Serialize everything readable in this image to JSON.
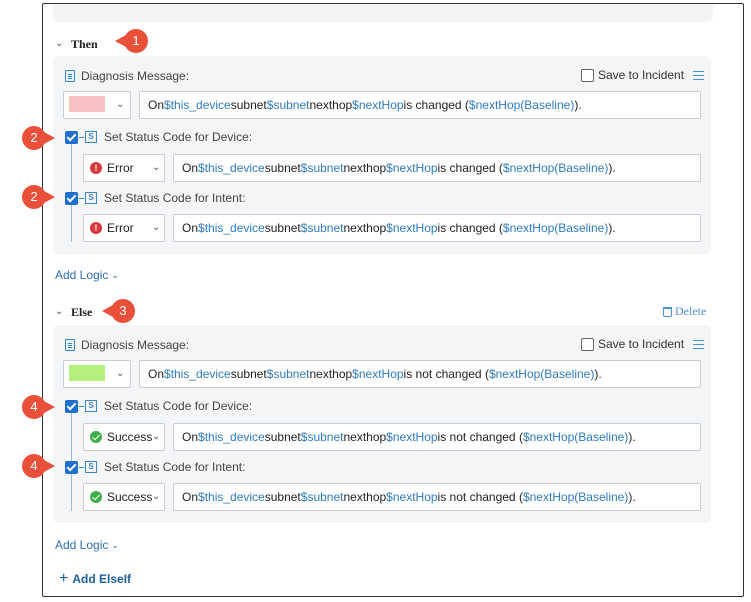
{
  "then": {
    "title": "Then",
    "callout": "1",
    "diagnosis_label": "Diagnosis Message:",
    "save_label": "Save to Incident",
    "swatch_color": "#f9c1c1",
    "message": {
      "p1": "On ",
      "v1": "$this_device",
      "p2": " subnet ",
      "v2": "$subnet",
      "p3": " nexthop ",
      "v3": "$nextHop",
      "p4": " is changed (",
      "v4": "$nextHop(Baseline)",
      "p5": ")."
    },
    "device": {
      "callout": "2",
      "label": "Set Status Code for Device:",
      "status": "Error",
      "message": {
        "p1": "On ",
        "v1": "$this_device",
        "p2": " subnet ",
        "v2": "$subnet",
        "p3": " nexthop ",
        "v3": "$nextHop",
        "p4": " is changed (",
        "v4": "$nextHop(Baseline)",
        "p5": ")."
      }
    },
    "intent": {
      "callout": "2",
      "label": "Set Status Code for Intent:",
      "status": "Error",
      "message": {
        "p1": "On ",
        "v1": "$this_device",
        "p2": " subnet ",
        "v2": "$subnet",
        "p3": " nexthop ",
        "v3": "$nextHop",
        "p4": " is changed (",
        "v4": "$nextHop(Baseline)",
        "p5": ")."
      }
    },
    "add_logic": "Add Logic"
  },
  "else": {
    "title": "Else",
    "callout": "3",
    "delete_label": "Delete",
    "diagnosis_label": "Diagnosis Message:",
    "save_label": "Save to Incident",
    "swatch_color": "#b4ef7f",
    "message": {
      "p1": "On ",
      "v1": "$this_device",
      "p2": " subnet ",
      "v2": "$subnet",
      "p3": " nexthop ",
      "v3": "$nextHop",
      "p4": " is not changed (",
      "v4": "$nextHop(Baseline)",
      "p5": ")."
    },
    "device": {
      "callout": "4",
      "label": "Set Status Code for Device:",
      "status": "Success",
      "message": {
        "p1": "On ",
        "v1": "$this_device",
        "p2": " subnet ",
        "v2": "$subnet",
        "p3": " nexthop ",
        "v3": "$nextHop",
        "p4": " is not changed (",
        "v4": "$nextHop(Baseline)",
        "p5": ")."
      }
    },
    "intent": {
      "callout": "4",
      "label": "Set Status Code for Intent:",
      "status": "Success",
      "message": {
        "p1": "On ",
        "v1": "$this_device",
        "p2": " subnet ",
        "v2": "$subnet",
        "p3": " nexthop ",
        "v3": "$nextHop",
        "p4": " is not changed (",
        "v4": "$nextHop(Baseline)",
        "p5": ")."
      }
    },
    "add_logic": "Add Logic"
  },
  "add_elseif": "Add ElseIf",
  "colors": {
    "accent": "#2f7bbf",
    "callout": "#e8503a",
    "error": "#d9363e",
    "success": "#3fae49"
  }
}
